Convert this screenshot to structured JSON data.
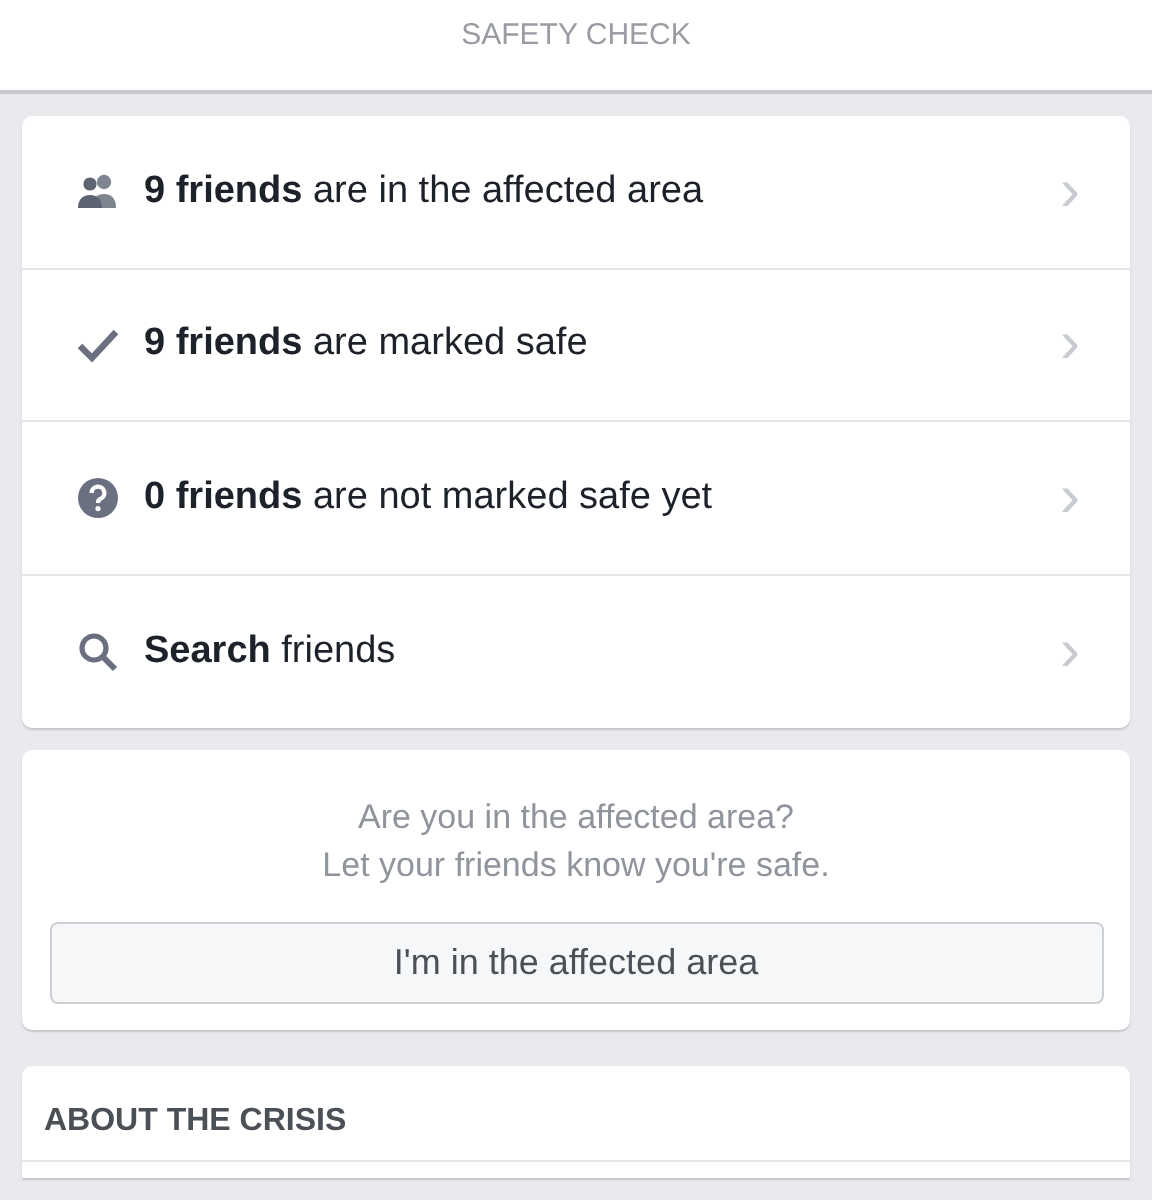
{
  "header": {
    "subtitle": "SAFETY CHECK"
  },
  "friend_rows": [
    {
      "text": "**9 friends** are in the affected area",
      "chevron": "›"
    },
    {
      "text": "**9 friends** are marked safe",
      "chevron": "›"
    },
    {
      "text": "**0 friends** are not marked safe yet",
      "chevron": "›"
    },
    {
      "text": "**Search** friends",
      "chevron": "›"
    }
  ],
  "prompt": {
    "lines": [
      "Are you in the affected area?",
      "Let your friends know you're safe."
    ],
    "button": "I'm in the affected area"
  },
  "about": {
    "heading": "ABOUT THE CRISIS"
  }
}
